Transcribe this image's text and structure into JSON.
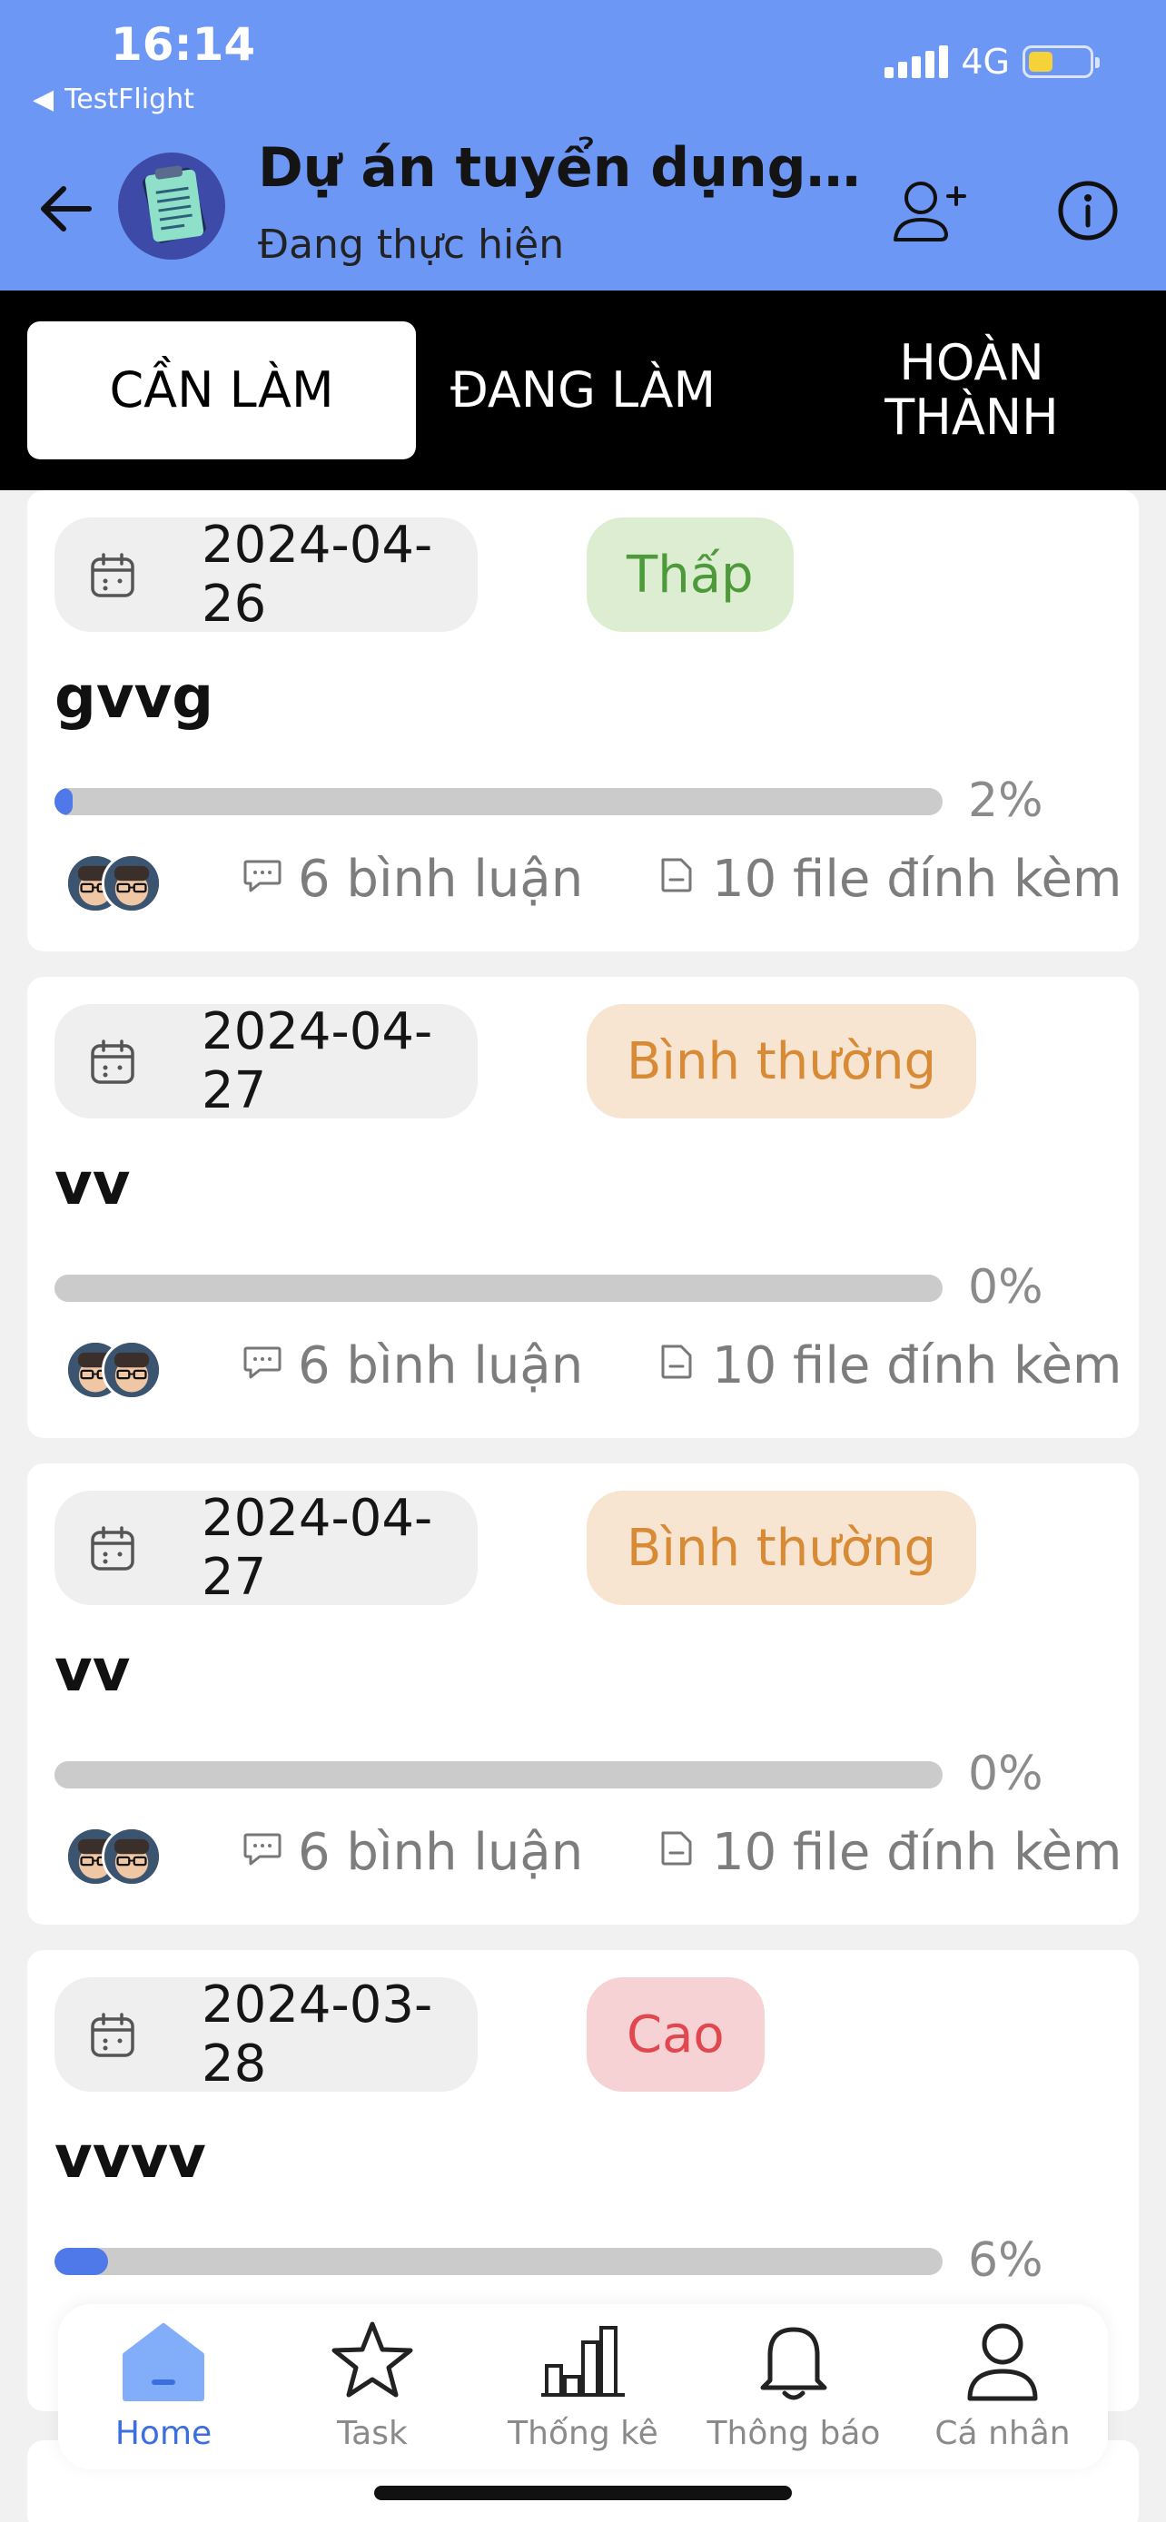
{
  "status_bar": {
    "time": "16:14",
    "back_app": "TestFlight",
    "network": "4G"
  },
  "header": {
    "title": "Dự án tuyển dụng nhâ...",
    "subtitle": "Đang thực hiện",
    "colors": {
      "background": "#6d97f5"
    }
  },
  "tabs": [
    {
      "label": "CẦN LÀM",
      "active": true
    },
    {
      "label": "ĐANG LÀM",
      "active": false
    },
    {
      "label": "HOÀN\nTHÀNH",
      "active": false
    }
  ],
  "tasks": [
    {
      "date": "2024-04-26",
      "priority": "Thấp",
      "priority_color": "#4c9a3a",
      "priority_bg": "#dcedd2",
      "title": "gvvg",
      "progress": 0.02,
      "progress_label": "2%",
      "comments": "6 bình luận",
      "files": "10 file đính kèm"
    },
    {
      "date": "2024-04-27",
      "priority": "Bình thường",
      "priority_color": "#d98a35",
      "priority_bg": "#f7e5d2",
      "title": "vv",
      "progress": 0.0,
      "progress_label": "0%",
      "comments": "6 bình luận",
      "files": "10 file đính kèm"
    },
    {
      "date": "2024-04-27",
      "priority": "Bình thường",
      "priority_color": "#d98a35",
      "priority_bg": "#f7e5d2",
      "title": "vv",
      "progress": 0.0,
      "progress_label": "0%",
      "comments": "6 bình luận",
      "files": "10 file đính kèm"
    },
    {
      "date": "2024-03-28",
      "priority": "Cao",
      "priority_color": "#e0474f",
      "priority_bg": "#f6d2d4",
      "title": "vvvv",
      "progress": 0.06,
      "progress_label": "6%",
      "comments": "",
      "files": ""
    }
  ],
  "bottom_nav": [
    {
      "label": "Home",
      "icon": "home-icon",
      "active": true
    },
    {
      "label": "Task",
      "icon": "star-icon",
      "active": false
    },
    {
      "label": "Thống kê",
      "icon": "chart-icon",
      "active": false
    },
    {
      "label": "Thông báo",
      "icon": "bell-icon",
      "active": false
    },
    {
      "label": "Cá nhân",
      "icon": "user-icon",
      "active": false
    }
  ],
  "colors": {
    "accent": "#3b6ee0",
    "progress": "#4f78e8"
  }
}
